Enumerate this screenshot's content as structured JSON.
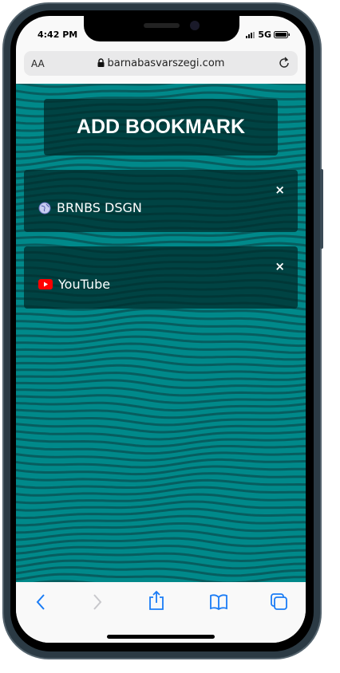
{
  "status_bar": {
    "time": "4:42 PM",
    "network": "5G"
  },
  "browser": {
    "text_size_label": "AA",
    "url": "barnabasvarszegi.com"
  },
  "page": {
    "add_button_label": "ADD BOOKMARK",
    "bookmarks": [
      {
        "label": "BRNBS DSGN",
        "icon": "globe-icon",
        "close": "×"
      },
      {
        "label": "YouTube",
        "icon": "youtube-icon",
        "close": "×"
      }
    ],
    "background_color": "#00898a"
  },
  "toolbar": {
    "accent": "#1a7cf5",
    "items": [
      "back",
      "forward",
      "share",
      "bookmarks",
      "tabs"
    ]
  }
}
